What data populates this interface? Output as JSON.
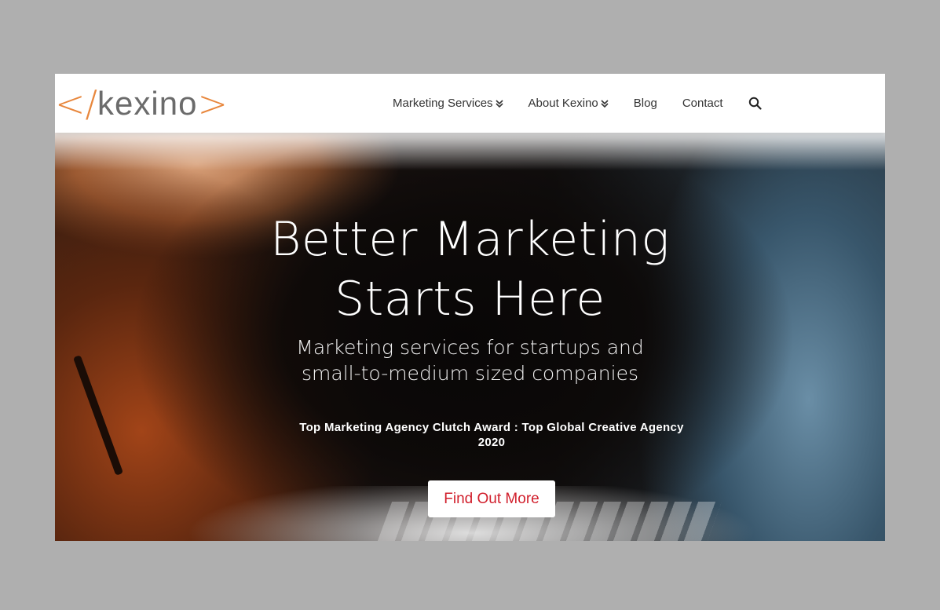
{
  "logo": {
    "open_bracket": "</",
    "word": "kexino",
    "close_bracket": ">"
  },
  "nav": {
    "items": [
      {
        "label": "Marketing Services",
        "has_dropdown": true
      },
      {
        "label": "About Kexino",
        "has_dropdown": true
      },
      {
        "label": "Blog",
        "has_dropdown": false
      },
      {
        "label": "Contact",
        "has_dropdown": false
      }
    ],
    "search_icon": "search-icon"
  },
  "hero": {
    "headline_line1": "Better Marketing",
    "headline_line2": "Starts Here",
    "subhead_line1": "Marketing services for startups and",
    "subhead_line2": "small-to-medium sized companies",
    "award_line1": "Top Marketing Agency Clutch Award : Top Global Creative Agency",
    "award_line2": "2020",
    "cta_label": "Find Out More"
  },
  "colors": {
    "page_background": "#afafaf",
    "logo_bracket": "#e8873d",
    "logo_word": "#6b6b6b",
    "cta_text": "#d11f2c"
  }
}
